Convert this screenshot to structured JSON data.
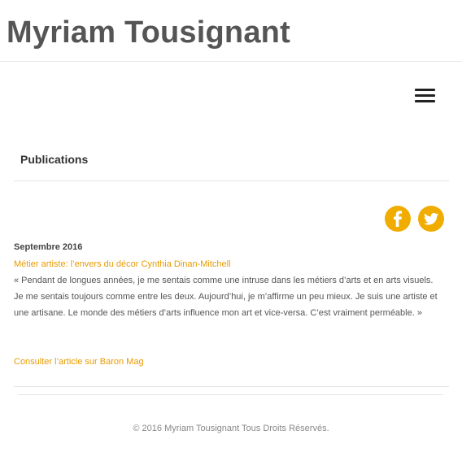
{
  "header": {
    "site_title": "Myriam Tousignant",
    "menu_icon": "hamburger-menu-icon"
  },
  "section": {
    "title": "Publications"
  },
  "social": {
    "accent_color": "#f0ad00",
    "items": [
      {
        "icon": "facebook-icon"
      },
      {
        "icon": "twitter-icon"
      }
    ]
  },
  "post": {
    "date": "Septembre 2016",
    "title_link": "Métier artiste: l’envers du décor Cynthia Dinan-Mitchell",
    "quote": "« Pendant de longues années, je me sentais comme une intruse dans les métiers d’arts et en arts visuels. Je me sentais toujours comme entre les deux. Aujourd’hui, je m’affirme un peu mieux. Je suis une artiste et une artisane. Le monde des métiers d’arts influence mon art et vice-versa. C’est vraiment perméable. »",
    "article_link": "Consulter l’article sur Baron Mag",
    "link_color": "#e89b00"
  },
  "footer": {
    "copyright": "© 2016 Myriam Tousignant Tous Droits Réservés."
  }
}
